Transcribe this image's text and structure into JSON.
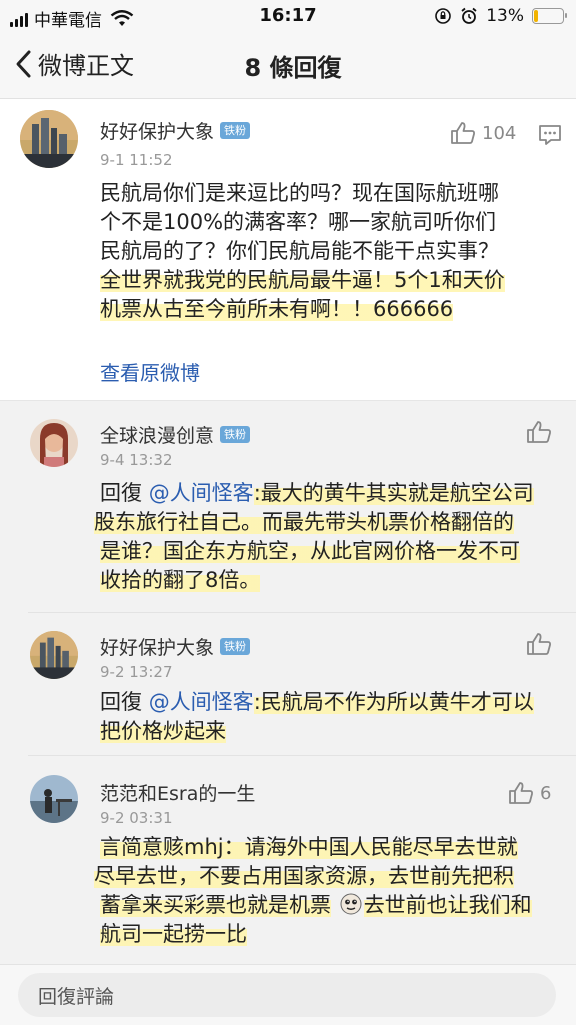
{
  "status": {
    "carrier": "中華電信",
    "time": "16:17",
    "battery": "13%"
  },
  "nav": {
    "back_label": "微博正文",
    "title": "8 條回復"
  },
  "post": {
    "author": "好好保护大象",
    "badge": "铁粉",
    "time": "9-1 11:52",
    "like_count": "104",
    "lines": [
      "民航局你们是来逗比的吗？现在国际航班哪",
      "个不是100%的满客率？哪一家航司听你们",
      "民航局的了？你们民航局能不能干点实事？",
      "全世界就我党的民航局最牛逼！5个1和天价",
      "机票从古至今前所未有啊！！666666"
    ],
    "view_original": "查看原微博"
  },
  "replies": [
    {
      "author": "全球浪漫创意",
      "badge": "铁粉",
      "time": "9-4 13:32",
      "prefix": "回復",
      "mention": "@人间怪客",
      "lines": [
        ":最大的黄牛其实就是航空公司",
        "股东旅行社自己。而最先带头机票价格翻倍的",
        "是谁？国企东方航空，从此官网价格一发不可",
        "收拾的翻了8倍。"
      ]
    },
    {
      "author": "好好保护大象",
      "badge": "铁粉",
      "time": "9-2 13:27",
      "prefix": "回復",
      "mention": "@人间怪客",
      "lines": [
        ":民航局不作为所以黄牛才可以",
        "把价格炒起来"
      ]
    },
    {
      "author": "范范和Esra的一生",
      "time": "9-2 03:31",
      "like_count": "6",
      "lines": [
        "言简意赅mhj：请海外中国人民能尽早去世就",
        "尽早去世，不要占用国家资源，去世前先把积",
        "蓄拿来买彩票也就是机票",
        "去世前也让我们和",
        "航司一起捞一比"
      ]
    }
  ],
  "reply_input": {
    "placeholder": "回復評論"
  }
}
